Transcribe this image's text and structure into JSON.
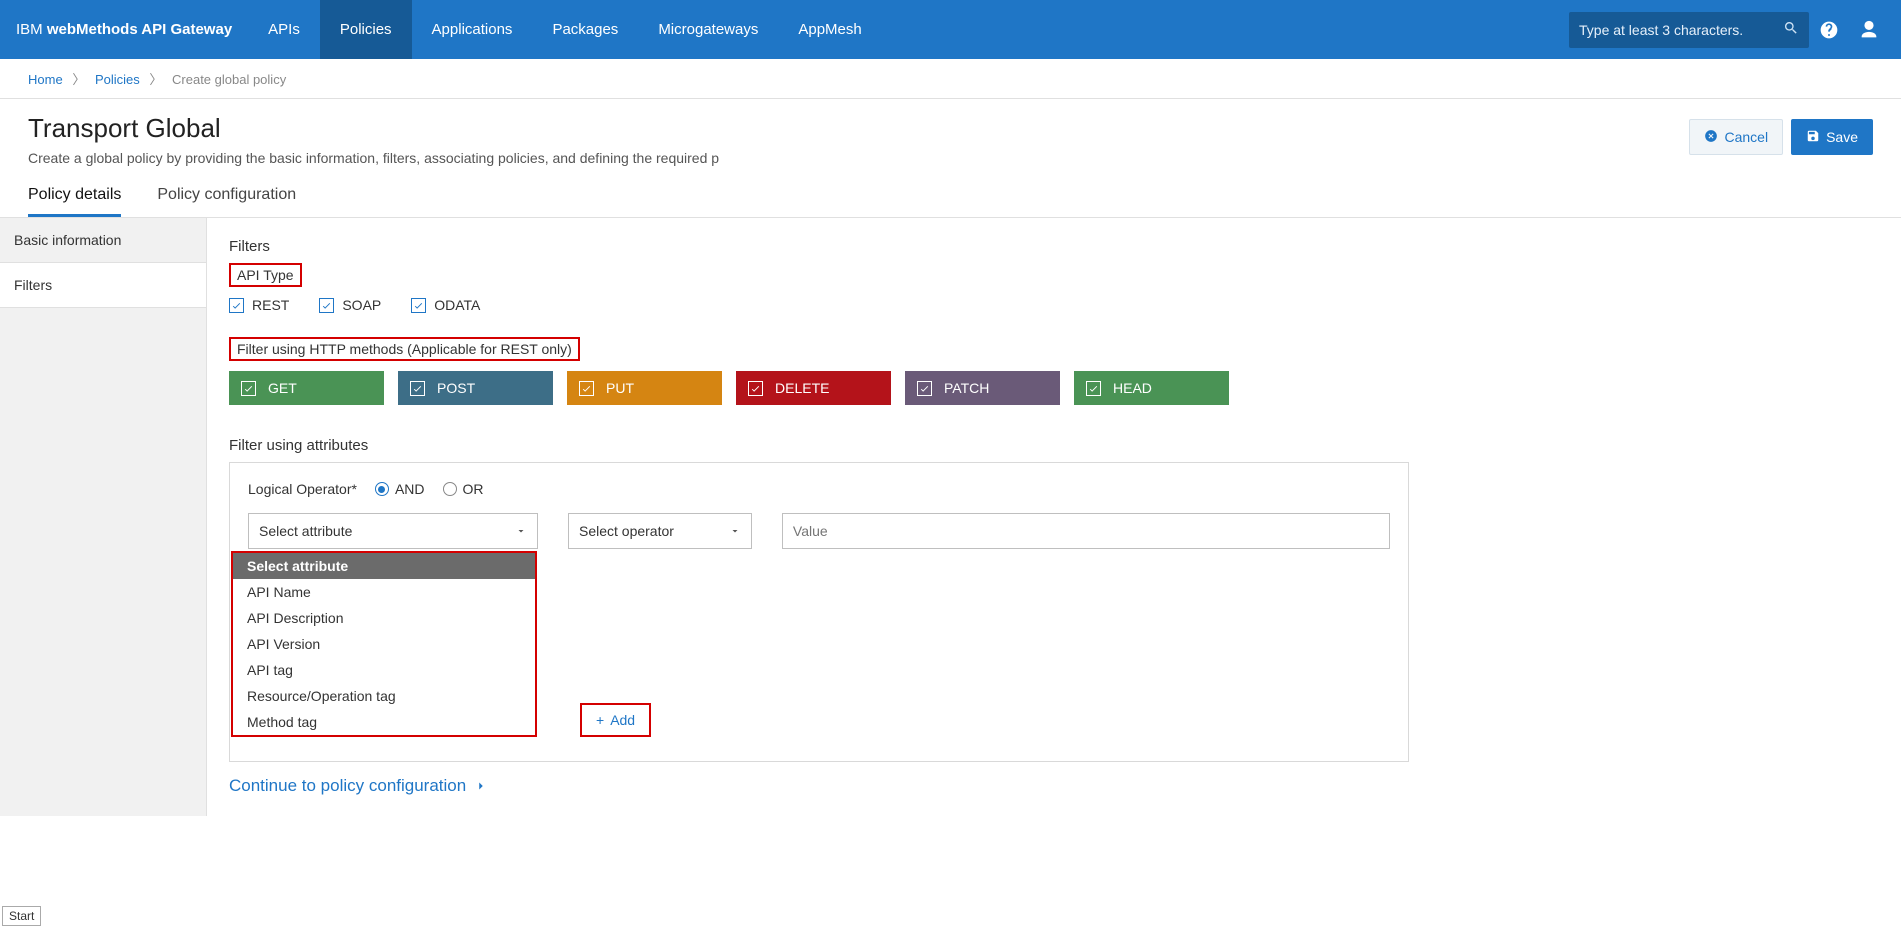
{
  "brand_prefix": "IBM ",
  "brand_bold": "webMethods API Gateway",
  "nav": [
    "APIs",
    "Policies",
    "Applications",
    "Packages",
    "Microgateways",
    "AppMesh"
  ],
  "nav_active_index": 1,
  "search_placeholder": "Type at least 3 characters.",
  "crumbs": {
    "home": "Home",
    "policies": "Policies",
    "current": "Create global policy"
  },
  "page": {
    "title": "Transport Global",
    "desc": "Create a global policy by providing the basic information, filters, associating policies, and defining the required p"
  },
  "btn_cancel": "Cancel",
  "btn_save": "Save",
  "inner_tabs": [
    "Policy details",
    "Policy configuration"
  ],
  "side_items": [
    "Basic information",
    "Filters"
  ],
  "filters_heading": "Filters",
  "api_type_label": "API Type",
  "api_types": [
    "REST",
    "SOAP",
    "ODATA"
  ],
  "http_label": "Filter using HTTP methods (Applicable for REST only)",
  "http_methods": [
    {
      "name": "GET",
      "cls": "c-get"
    },
    {
      "name": "POST",
      "cls": "c-post"
    },
    {
      "name": "PUT",
      "cls": "c-put"
    },
    {
      "name": "DELETE",
      "cls": "c-del"
    },
    {
      "name": "PATCH",
      "cls": "c-patch"
    },
    {
      "name": "HEAD",
      "cls": "c-head"
    }
  ],
  "attr_heading": "Filter using attributes",
  "logical_label": "Logical Operator*",
  "logical_and": "AND",
  "logical_or": "OR",
  "select_attribute": "Select attribute",
  "select_operator": "Select operator",
  "value_placeholder": "Value",
  "dropdown_options": [
    "Select attribute",
    "API Name",
    "API Description",
    "API Version",
    "API tag",
    "Resource/Operation tag",
    "Method tag"
  ],
  "add_label": "Add",
  "continue_label": "Continue to policy configuration",
  "start_chip": "Start"
}
